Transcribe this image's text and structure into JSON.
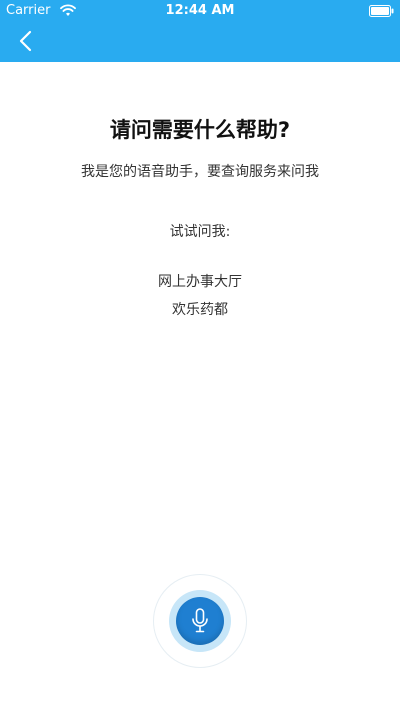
{
  "status_bar": {
    "carrier": "Carrier",
    "time": "12:44 AM"
  },
  "colors": {
    "accent": "#29abf0",
    "mic_button": "#1f7fd1",
    "mic_halo": "#c7e6f8"
  },
  "header": {
    "back_icon": "chevron-left-icon"
  },
  "main": {
    "title": "请问需要什么帮助?",
    "subtitle": "我是您的语音助手，要查询服务来问我",
    "try_label": "试试问我:",
    "suggestions": [
      "网上办事大厅",
      "欢乐药都"
    ]
  },
  "voice": {
    "icon": "microphone-icon"
  }
}
